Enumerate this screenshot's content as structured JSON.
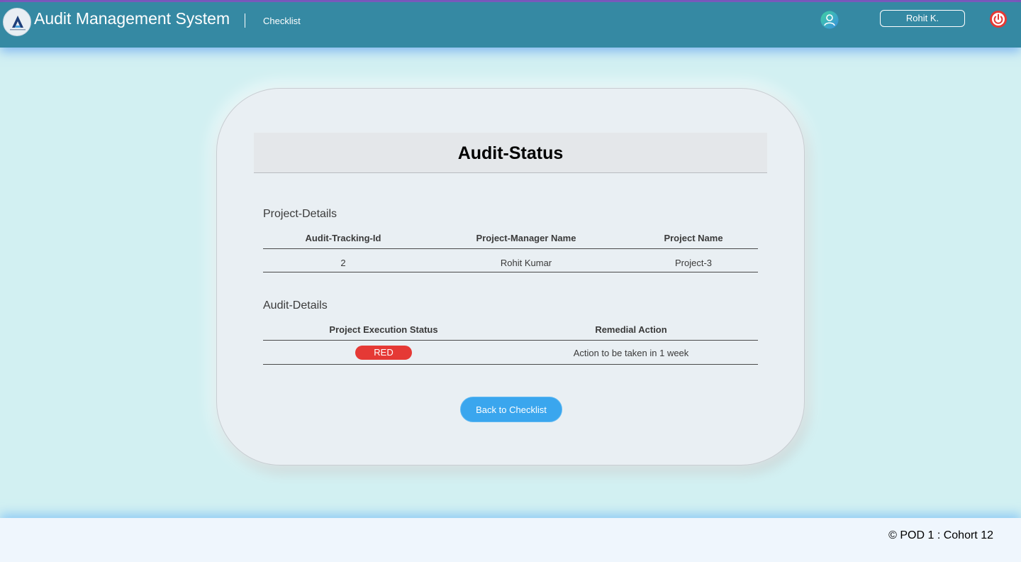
{
  "header": {
    "app_title": "Audit Management System",
    "nav_link": "Checklist",
    "user_name": "Rohit K.",
    "icons": {
      "logo": "app-logo",
      "user": "user-icon",
      "logout": "power-icon"
    },
    "colors": {
      "navbar": "#3589a3",
      "logout": "#e53935"
    }
  },
  "card": {
    "title": "Audit-Status",
    "project_section": {
      "title": "Project-Details",
      "columns": [
        "Audit-Tracking-Id",
        "Project-Manager Name",
        "Project Name"
      ],
      "row": [
        "2",
        "Rohit Kumar",
        "Project-3"
      ]
    },
    "audit_section": {
      "title": "Audit-Details",
      "columns": [
        "Project Execution Status",
        "Remedial Action"
      ],
      "status": "RED",
      "status_color": "#e53935",
      "remedial_action": "Action to be taken in 1 week"
    },
    "back_button": "Back to Checklist"
  },
  "footer": {
    "text": "© POD 1 : Cohort 12"
  }
}
